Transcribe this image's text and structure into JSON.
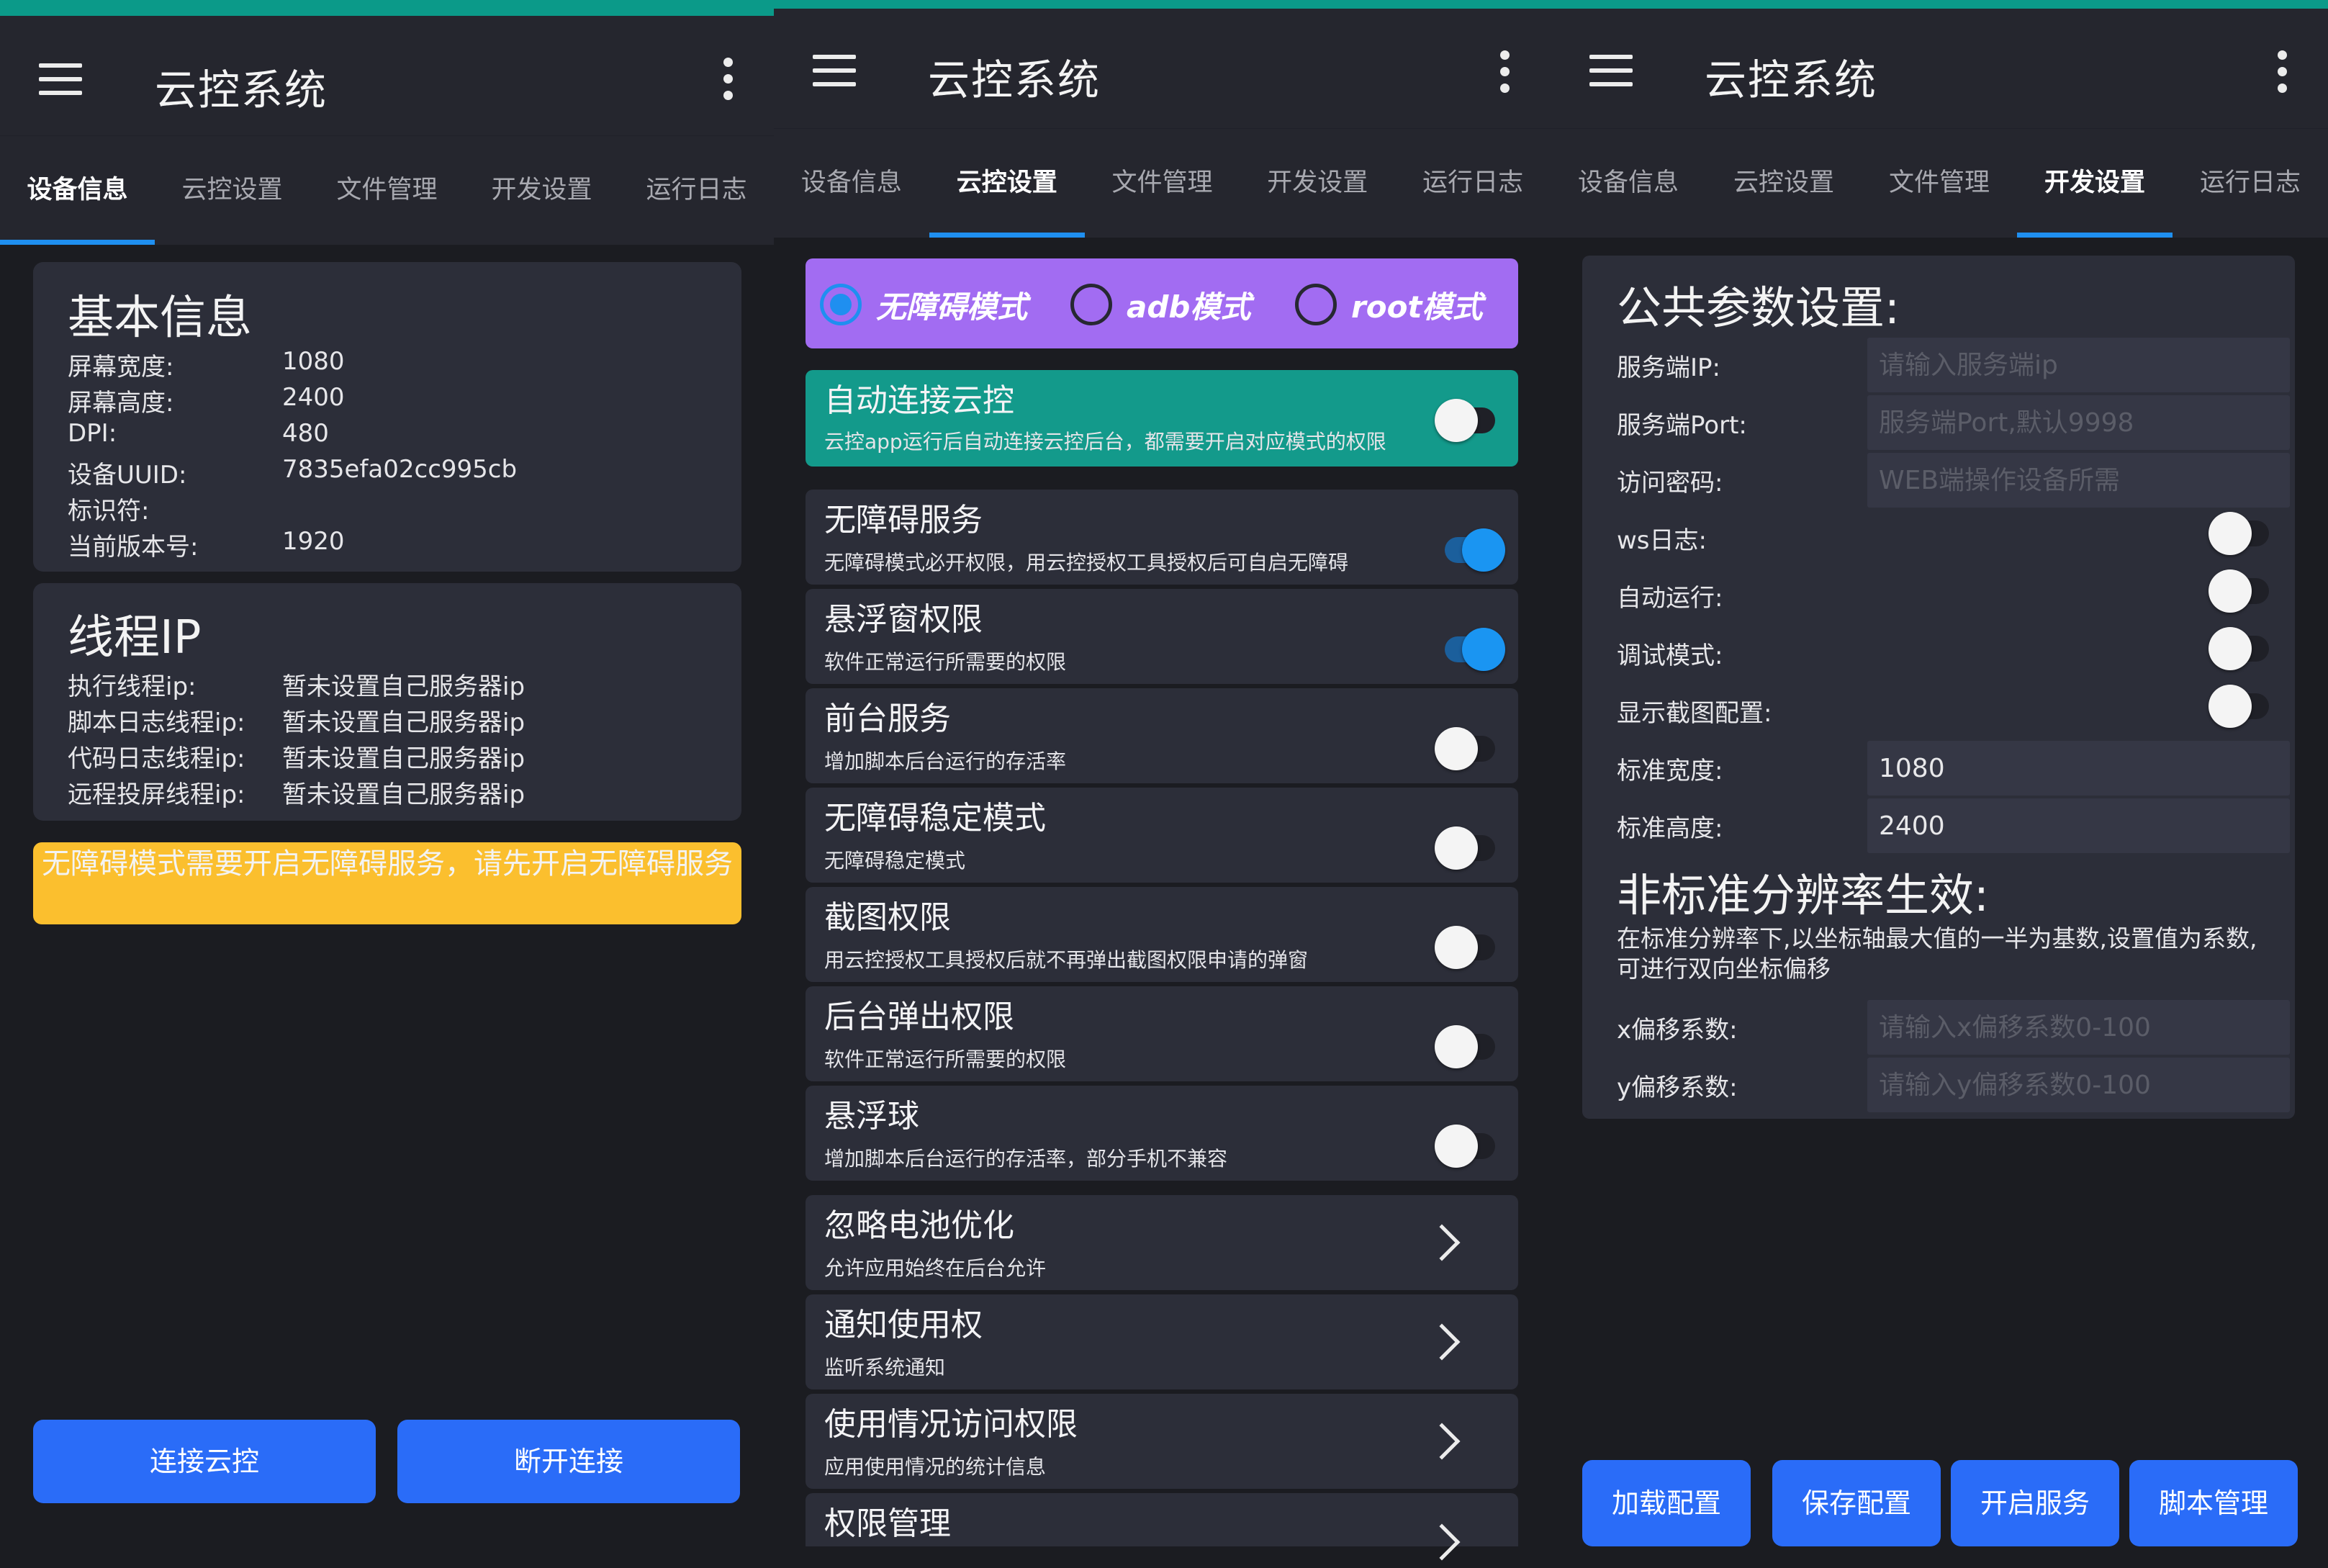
{
  "app": {
    "title": "云控系统"
  },
  "tabs": [
    "设备信息",
    "云控设置",
    "文件管理",
    "开发设置",
    "运行日志"
  ],
  "panel1": {
    "basic": {
      "title": "基本信息",
      "rows": [
        {
          "k": "屏幕宽度:",
          "v": "1080"
        },
        {
          "k": "屏幕高度:",
          "v": "2400"
        },
        {
          "k": "DPI:",
          "v": "480"
        },
        {
          "k": "设备UUID:",
          "v": "7835efa02cc995cb"
        },
        {
          "k": "标识符:",
          "v": ""
        },
        {
          "k": "当前版本号:",
          "v": "1920"
        }
      ]
    },
    "thread": {
      "title": "线程IP",
      "rows": [
        {
          "k": "执行线程ip:",
          "v": "暂未设置自己服务器ip"
        },
        {
          "k": "脚本日志线程ip:",
          "v": "暂未设置自己服务器ip"
        },
        {
          "k": "代码日志线程ip:",
          "v": "暂未设置自己服务器ip"
        },
        {
          "k": "远程投屏线程ip:",
          "v": "暂未设置自己服务器ip"
        }
      ]
    },
    "warning": "无障碍模式需要开启无障碍服务，请先开启无障碍服务",
    "connect_label": "连接云控",
    "disconnect_label": "断开连接"
  },
  "panel2": {
    "modes": [
      {
        "label": "无障碍模式",
        "selected": true
      },
      {
        "label": "adb模式",
        "selected": false
      },
      {
        "label": "root模式",
        "selected": false
      }
    ],
    "rows": [
      {
        "title": "自动连接云控",
        "sub": "云控app运行后自动连接云控后台，都需要开启对应模式的权限",
        "control": "switch",
        "on": false
      },
      {
        "title": "无障碍服务",
        "sub": "无障碍模式必开权限，用云控授权工具授权后可自启无障碍",
        "control": "switch",
        "on": true
      },
      {
        "title": "悬浮窗权限",
        "sub": "软件正常运行所需要的权限",
        "control": "switch",
        "on": true
      },
      {
        "title": "前台服务",
        "sub": "增加脚本后台运行的存活率",
        "control": "switch",
        "on": false
      },
      {
        "title": "无障碍稳定模式",
        "sub": "无障碍稳定模式",
        "control": "switch",
        "on": false
      },
      {
        "title": "截图权限",
        "sub": "用云控授权工具授权后就不再弹出截图权限申请的弹窗",
        "control": "switch",
        "on": false
      },
      {
        "title": "后台弹出权限",
        "sub": "软件正常运行所需要的权限",
        "control": "switch",
        "on": false
      },
      {
        "title": "悬浮球",
        "sub": "增加脚本后台运行的存活率，部分手机不兼容",
        "control": "switch",
        "on": false
      },
      {
        "title": "忽略电池优化",
        "sub": "允许应用始终在后台允许",
        "control": "chevron"
      },
      {
        "title": "通知使用权",
        "sub": "监听系统通知",
        "control": "chevron"
      },
      {
        "title": "使用情况访问权限",
        "sub": "应用使用情况的统计信息",
        "control": "chevron"
      },
      {
        "title": "权限管理",
        "sub": "",
        "control": "chevron"
      }
    ]
  },
  "panel3": {
    "public_title": "公共参数设置:",
    "server_ip": {
      "label": "服务端IP:",
      "placeholder": "请输入服务端ip",
      "value": ""
    },
    "server_port": {
      "label": "服务端Port:",
      "placeholder": "服务端Port,默认9998",
      "value": ""
    },
    "access_pwd": {
      "label": "访问密码:",
      "placeholder": "WEB端操作设备所需",
      "value": ""
    },
    "toggles": [
      {
        "label": "ws日志:",
        "on": false
      },
      {
        "label": "自动运行:",
        "on": false
      },
      {
        "label": "调试模式:",
        "on": false
      },
      {
        "label": "显示截图配置:",
        "on": false
      }
    ],
    "std_width": {
      "label": "标准宽度:",
      "value": "1080"
    },
    "std_height": {
      "label": "标准高度:",
      "value": "2400"
    },
    "nonstd_title": "非标准分辨率生效:",
    "nonstd_desc": "在标准分辨率下,以坐标轴最大值的一半为基数,设置值为系数,可进行双向坐标偏移",
    "x_offset": {
      "label": "x偏移系数:",
      "placeholder": "请输入x偏移系数0-100",
      "value": ""
    },
    "y_offset": {
      "label": "y偏移系数:",
      "placeholder": "请输入y偏移系数0-100",
      "value": ""
    },
    "buttons": [
      "加载配置",
      "保存配置",
      "开启服务",
      "脚本管理"
    ]
  },
  "colors": {
    "status_bar": "#0b9a89",
    "accent": "#1f8ff0",
    "button": "#2a6cf8",
    "warning": "#fbbf2e",
    "mode_bar": "#a26cf2",
    "teal_row": "#139a8b"
  }
}
